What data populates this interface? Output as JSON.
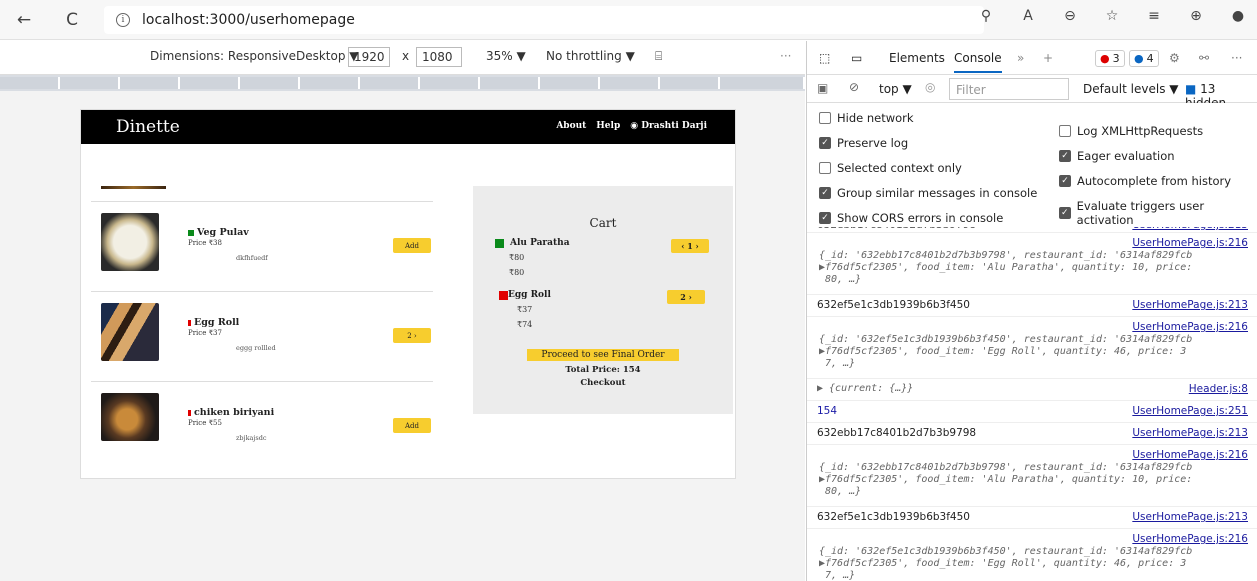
{
  "browser": {
    "url": "localhost:3000/userhomepage",
    "back_icon": "←",
    "reload_icon": "C",
    "info_icon": "i"
  },
  "devbar": {
    "dimensions_label": "Dimensions: ResponsiveDesktop ▼",
    "width": "1920",
    "times": "x",
    "height": "1080",
    "zoom": "35% ▼",
    "throttle": "No throttling ▼",
    "more": "···"
  },
  "site": {
    "brand": "Dinette",
    "nav": [
      "About",
      "Help",
      "◉ Drashti Darji"
    ]
  },
  "menu": [
    {
      "name": "Veg Pulav",
      "price": "Price ₹38",
      "desc": "dkfhfuedf",
      "button": "Add",
      "veg_color": "#0a8a1a"
    },
    {
      "name": "Egg Roll",
      "price": "Price ₹37",
      "desc": "eggg rollled",
      "button": "2 ›",
      "veg_color": "#e00000"
    },
    {
      "name": "chiken biriyani",
      "price": "Price ₹55",
      "desc": "zbjkajsdc",
      "button": "Add",
      "veg_color": "#e00000"
    }
  ],
  "cart": {
    "title": "Cart",
    "items": [
      {
        "name": "Alu Paratha",
        "price1": "₹80",
        "price2": "₹80",
        "button": "‹ 1 ›",
        "color": "#0a8a1a"
      },
      {
        "name": "Egg Roll",
        "price1": "₹37",
        "price2": "₹74",
        "button": "2 ›",
        "color": "#e00000"
      }
    ],
    "proceed": "Proceed to see Final Order",
    "total": "Total Price: 154",
    "checkout": "Checkout"
  },
  "devtools": {
    "tabs": [
      "Elements",
      "Console"
    ],
    "more": "»",
    "plus": "+",
    "errors": "3",
    "infos": "4",
    "context": "top ▼",
    "filter_placeholder": "Filter",
    "levels": "Default levels ▼",
    "hidden": "13 hidden",
    "settings_left": [
      {
        "label": "Hide network",
        "checked": false
      },
      {
        "label": "Preserve log",
        "checked": true
      },
      {
        "label": "Selected context only",
        "checked": false
      },
      {
        "label": "Group similar messages in console",
        "checked": true
      },
      {
        "label": "Show CORS errors in console",
        "checked": true
      }
    ],
    "settings_right": [
      {
        "label": "Log XMLHttpRequests",
        "checked": false
      },
      {
        "label": "Eager evaluation",
        "checked": true
      },
      {
        "label": "Autocomplete from history",
        "checked": true
      },
      {
        "label": "Evaluate triggers user activation",
        "checked": true
      }
    ],
    "console": {
      "partial_id": "632ebb17c8401b2d7b3b9798",
      "partial_src": "UserHomePage.js:213",
      "src_216": "UserHomePage.js:216",
      "src_213": "UserHomePage.js:213",
      "obj_alu": "{_id: '632ebb17c8401b2d7b3b9798', restaurant_id: '6314af829fcb\n▶f76df5cf2305', food_item: 'Alu Paratha', quantity: 10, price:\n 80, …}",
      "id_egg": "632ef5e1c3db1939b6b3f450",
      "obj_egg": "{_id: '632ef5e1c3db1939b6b3f450', restaurant_id: '6314af829fcb\n▶f76df5cf2305', food_item: 'Egg Roll', quantity: 46, price: 3\n 7, …}",
      "current": "▶ {current: {…}}",
      "header_src": "Header.js:8",
      "total_num": "154",
      "src_251": "UserHomePage.js:251",
      "id_alu": "632ebb17c8401b2d7b3b9798"
    }
  }
}
